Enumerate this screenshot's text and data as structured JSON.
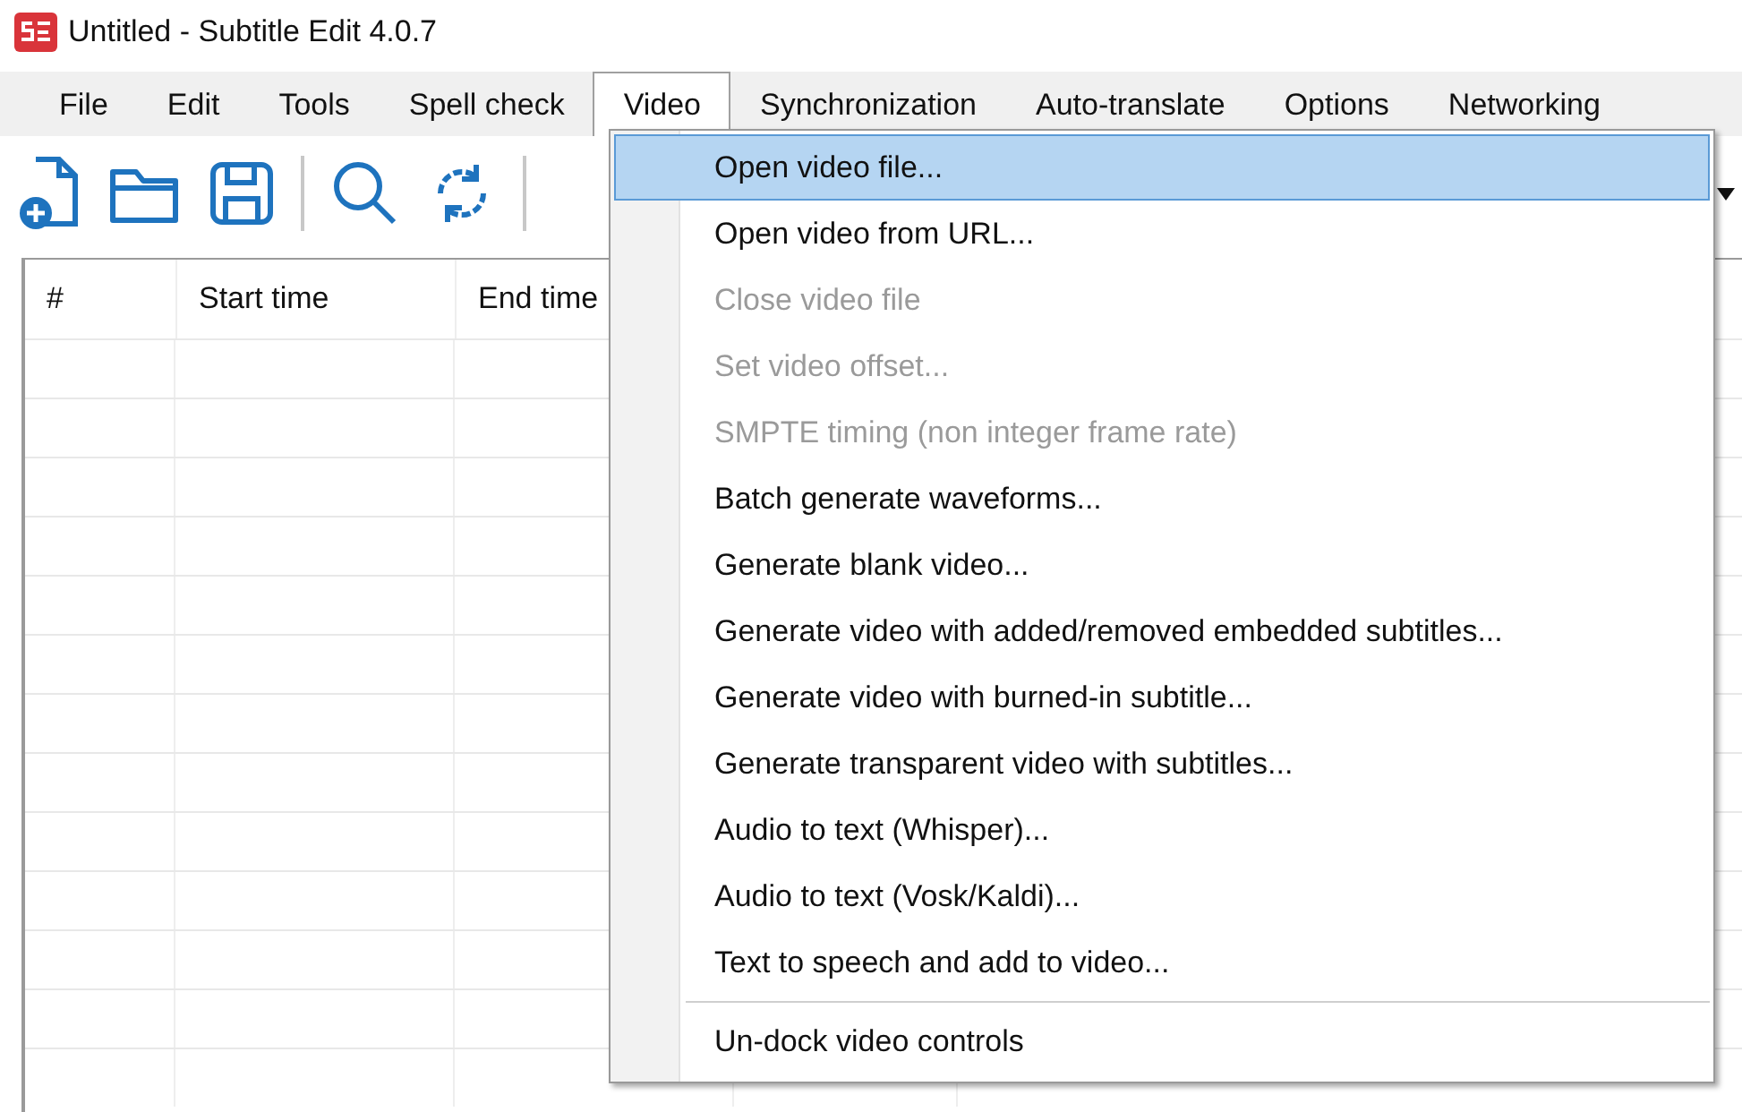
{
  "window": {
    "title": "Untitled - Subtitle Edit 4.0.7"
  },
  "menu_bar": [
    {
      "label": "File",
      "selected": false
    },
    {
      "label": "Edit",
      "selected": false
    },
    {
      "label": "Tools",
      "selected": false
    },
    {
      "label": "Spell check",
      "selected": false
    },
    {
      "label": "Video",
      "selected": true
    },
    {
      "label": "Synchronization",
      "selected": false
    },
    {
      "label": "Auto-translate",
      "selected": false
    },
    {
      "label": "Options",
      "selected": false
    },
    {
      "label": "Networking",
      "selected": false
    }
  ],
  "table": {
    "columns": [
      "#",
      "Start time",
      "End time"
    ]
  },
  "video_menu": [
    {
      "kind": "item",
      "label": "Open video file...",
      "selected": true,
      "disabled": false
    },
    {
      "kind": "item",
      "label": "Open video from URL...",
      "selected": false,
      "disabled": false
    },
    {
      "kind": "item",
      "label": "Close video file",
      "selected": false,
      "disabled": true
    },
    {
      "kind": "item",
      "label": "Set video offset...",
      "selected": false,
      "disabled": true
    },
    {
      "kind": "item",
      "label": "SMPTE timing (non integer frame rate)",
      "selected": false,
      "disabled": true
    },
    {
      "kind": "item",
      "label": "Batch generate waveforms...",
      "selected": false,
      "disabled": false
    },
    {
      "kind": "item",
      "label": "Generate blank video...",
      "selected": false,
      "disabled": false
    },
    {
      "kind": "item",
      "label": "Generate video with added/removed embedded subtitles...",
      "selected": false,
      "disabled": false
    },
    {
      "kind": "item",
      "label": "Generate video with burned-in subtitle...",
      "selected": false,
      "disabled": false
    },
    {
      "kind": "item",
      "label": "Generate transparent video with subtitles...",
      "selected": false,
      "disabled": false
    },
    {
      "kind": "item",
      "label": "Audio to text (Whisper)...",
      "selected": false,
      "disabled": false
    },
    {
      "kind": "item",
      "label": "Audio to text (Vosk/Kaldi)...",
      "selected": false,
      "disabled": false
    },
    {
      "kind": "item",
      "label": "Text to speech and add to video...",
      "selected": false,
      "disabled": false
    },
    {
      "kind": "separator"
    },
    {
      "kind": "item",
      "label": "Un-dock video controls",
      "selected": false,
      "disabled": false
    }
  ]
}
